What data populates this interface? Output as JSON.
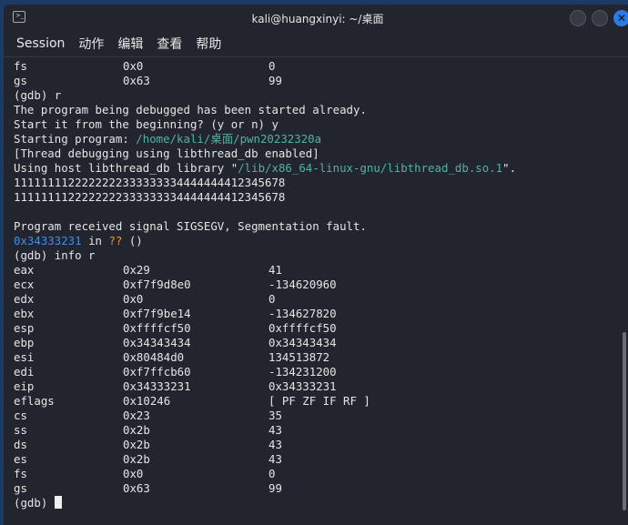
{
  "window": {
    "title": "kali@huangxinyi: ~/桌面",
    "icon": "terminal-icon"
  },
  "menu": [
    "Session",
    "动作",
    "编辑",
    "查看",
    "帮助"
  ],
  "colors": {
    "path": "#4fb3a0",
    "address": "#3f8fe8",
    "unknown": "#e0a030"
  },
  "terminal": {
    "top_regs": [
      [
        "fs",
        "0x0",
        "0"
      ],
      [
        "gs",
        "0x63",
        "99"
      ]
    ],
    "lines": [
      "(gdb) r",
      "The program being debugged has been started already.",
      "Start it from the beginning? (y or n) y"
    ],
    "starting_prefix": "Starting program: ",
    "starting_path": "/home/kali/桌面/pwn20232320a",
    "thread_line": "[Thread debugging using libthread_db enabled]",
    "host_prefix": "Using host libthread_db library \"",
    "host_path": "/lib/x86_64-linux-gnu/libthread_db.so.1",
    "host_suffix": "\".",
    "out1": "1111111122222222333333334444444412345678",
    "out2": "1111111122222222333333334444444412345678",
    "signal": "Program received signal SIGSEGV, Segmentation fault.",
    "fault_addr": "0x34333231",
    "fault_in": " in ",
    "fault_q": "??",
    "fault_paren": " ()",
    "info_cmd": "(gdb) info r",
    "regs": [
      [
        "eax",
        "0x29",
        "41"
      ],
      [
        "ecx",
        "0xf7f9d8e0",
        "-134620960"
      ],
      [
        "edx",
        "0x0",
        "0"
      ],
      [
        "ebx",
        "0xf7f9be14",
        "-134627820"
      ],
      [
        "esp",
        "0xffffcf50",
        "0xffffcf50"
      ],
      [
        "ebp",
        "0x34343434",
        "0x34343434"
      ],
      [
        "esi",
        "0x80484d0",
        "134513872"
      ],
      [
        "edi",
        "0xf7ffcb60",
        "-134231200"
      ],
      [
        "eip",
        "0x34333231",
        "0x34333231"
      ],
      [
        "eflags",
        "0x10246",
        "[ PF ZF IF RF ]"
      ],
      [
        "cs",
        "0x23",
        "35"
      ],
      [
        "ss",
        "0x2b",
        "43"
      ],
      [
        "ds",
        "0x2b",
        "43"
      ],
      [
        "es",
        "0x2b",
        "43"
      ],
      [
        "fs",
        "0x0",
        "0"
      ],
      [
        "gs",
        "0x63",
        "99"
      ]
    ],
    "prompt": "(gdb) "
  }
}
